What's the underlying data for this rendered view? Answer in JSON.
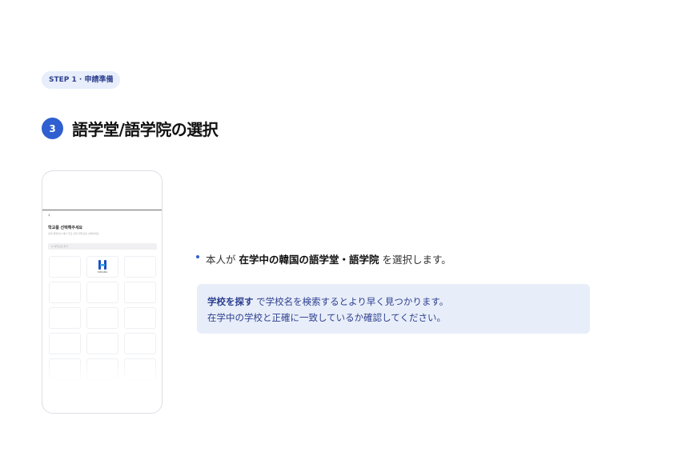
{
  "step_pill": "STEP 1 · 申請準備",
  "section": {
    "number": "3",
    "title": "語学堂/語学院の選択"
  },
  "phone": {
    "back_icon": "chevron-left-icon",
    "screen_title": "학교를 선택해주세요",
    "screen_subtitle": "검색 화면이나 배너 학교 선택 대학교를 선택하세요.",
    "search_placeholder": "Q 대학교로 찾기",
    "logo_label": "HANSUNG"
  },
  "bullet": {
    "prefix": "本人が",
    "emphasis": "在学中の韓国の語学堂・語学院",
    "suffix": "を選択します。"
  },
  "note": {
    "line1_bold": "学校を探す",
    "line1_rest": " で学校名を検索するとより早く見つかります。",
    "line2": "在学中の学校と正確に一致しているか確認してください。"
  },
  "colors": {
    "accent": "#2f5fd0",
    "note_bg": "#e8eef9",
    "pill_bg": "#e8eefb"
  }
}
